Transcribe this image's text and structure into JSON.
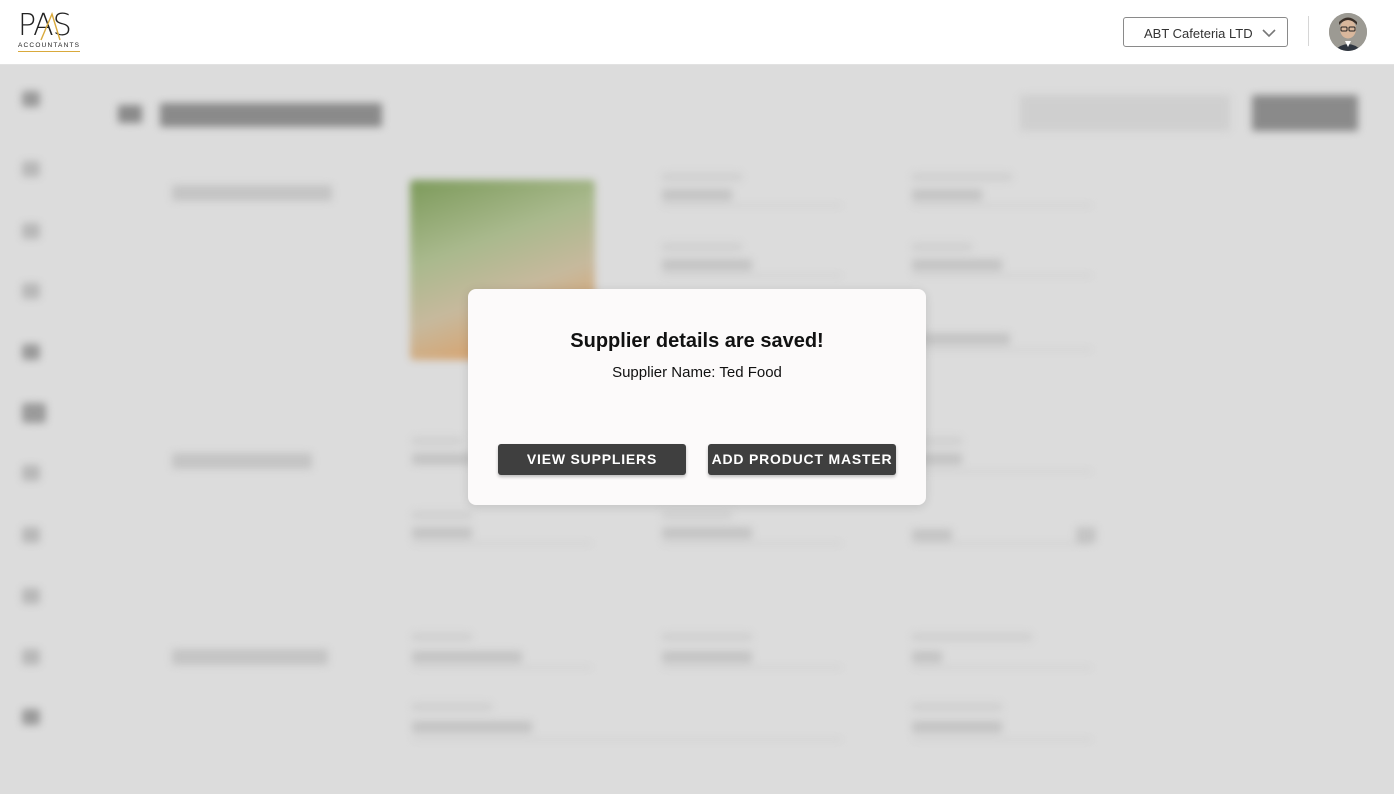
{
  "header": {
    "logo_text": "PAS",
    "logo_subtext": "ACCOUNTANTS",
    "company_select": {
      "value": "ABT Cafeteria LTD",
      "icon": "chevron-down-icon"
    },
    "avatar": "user-avatar"
  },
  "modal": {
    "title": "Supplier details are saved!",
    "subtitle": "Supplier Name: Ted Food",
    "view_button": "VIEW SUPPLIERS",
    "add_button": "ADD PRODUCT MASTER"
  },
  "colors": {
    "button_bg": "#3f3f3f",
    "logo_accent": "#d9a93b",
    "modal_bg": "#fcfafa",
    "overlay_bg": "#dcdcdc"
  }
}
